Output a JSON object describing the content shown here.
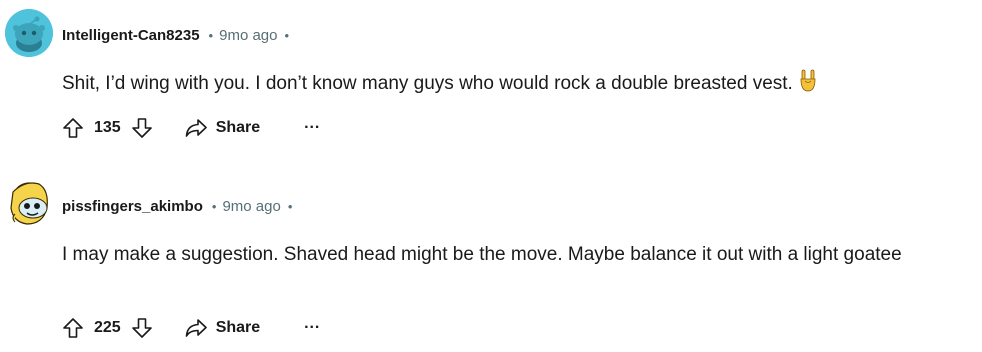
{
  "comments": [
    {
      "username": "Intelligent-Can8235",
      "separator": "•",
      "time": "9mo ago",
      "trailing": "•",
      "body": "Shit, I’d wing with you. I don’t know many guys who would rock a double breasted vest.",
      "emoji_icon": "rock-hand-icon",
      "votes": "135",
      "share_label": "Share",
      "more_label": "···",
      "avatar_color": "#4fc2dc"
    },
    {
      "username": "pissfingers_akimbo",
      "separator": "•",
      "time": "9mo ago",
      "trailing": "•",
      "body": "I may make a suggestion. Shaved head might be the move. Maybe balance it out with a light goatee",
      "votes": "225",
      "share_label": "Share",
      "more_label": "···",
      "avatar_color": "#f5d34a"
    }
  ]
}
